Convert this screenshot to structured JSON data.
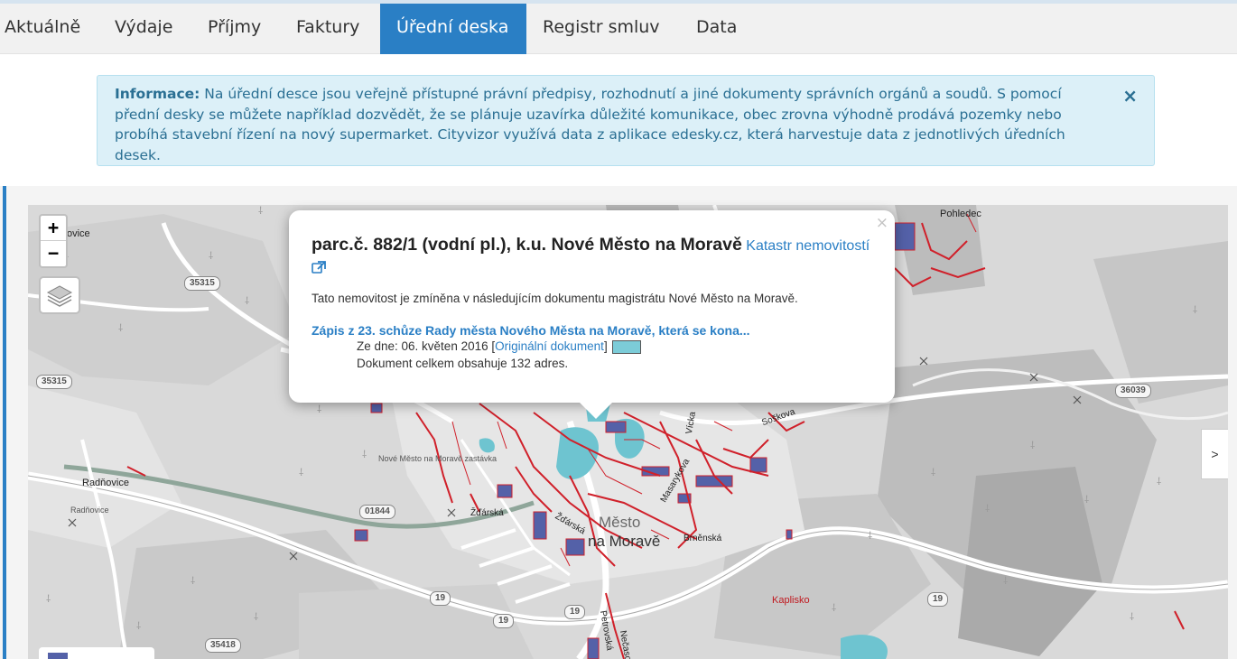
{
  "nav": {
    "items": [
      {
        "label": "Aktuálně"
      },
      {
        "label": "Výdaje"
      },
      {
        "label": "Příjmy"
      },
      {
        "label": "Faktury"
      },
      {
        "label": "Úřední deska",
        "active": true
      },
      {
        "label": "Registr smluv"
      },
      {
        "label": "Data"
      }
    ]
  },
  "alert": {
    "lead": "Informace:",
    "text": "Na úřední desce jsou veřejně přístupné právní předpisy, rozhodnutí a jiné dokumenty správních orgánů a soudů. S pomocí přední desky se můžete například dozvědět, že se plánuje uzavírka důležité komunikace, obec zrovna výhodně prodává pozemky nebo probíhá stavební řízení na nový supermarket. Cityvizor využívá data z aplikace edesky.cz, která harvestuje data z jednotlivých úředních desek.",
    "close": "×"
  },
  "map": {
    "zoom_in": "+",
    "zoom_out": "−",
    "next": ">",
    "labels": {
      "novice": "ovice",
      "podedec": "Pohledec",
      "radnovice": "Radňovice",
      "radnovice_small": "Radňovice",
      "nmm_zastavka": "Nové Město na Moravě zastávka",
      "zdarska": "Žďárská",
      "soskova": "Soškova",
      "brnenska": "Brněnská",
      "kaplisko": "Kaplisko",
      "mesto": "Město",
      "moravě": "na Moravě",
      "masarykova": "Masarykova",
      "petrovska": "Petrovská",
      "necasova": "Nečasova",
      "vicka": "Vícka",
      "zdarska2": "Žďárská"
    },
    "roads": {
      "r35315a": "35315",
      "r35315b": "35315",
      "r36039": "36039",
      "r01844": "01844",
      "r19a": "19",
      "r19b": "19",
      "r19c": "19",
      "r19d": "19",
      "r35418": "35418"
    }
  },
  "popup": {
    "close": "×",
    "title": "parc.č. 882/1 (vodní pl.), k.u. Nové Město na Moravě",
    "katastr_link": "Katastr nemovitostí",
    "intro": "Tato nemovitost je zmíněna v následujícím dokumentu magistrátu Nové Město na Moravě.",
    "doc_title": "Zápis z 23. schůze Rady města Nového Města na Moravě, která se kona...",
    "doc_date_prefix": "Ze dne: 06. květen 2016 [",
    "doc_original": "Originální dokument",
    "doc_date_suffix": "]",
    "doc_count": "Dokument celkem obsahuje 132 adres."
  },
  "colors": {
    "accent": "#2a7fc5",
    "alert_bg": "#dcf0f8",
    "parcel_red": "#d0202a",
    "parcel_blue": "#5461a8",
    "water": "#6ec4d0"
  }
}
